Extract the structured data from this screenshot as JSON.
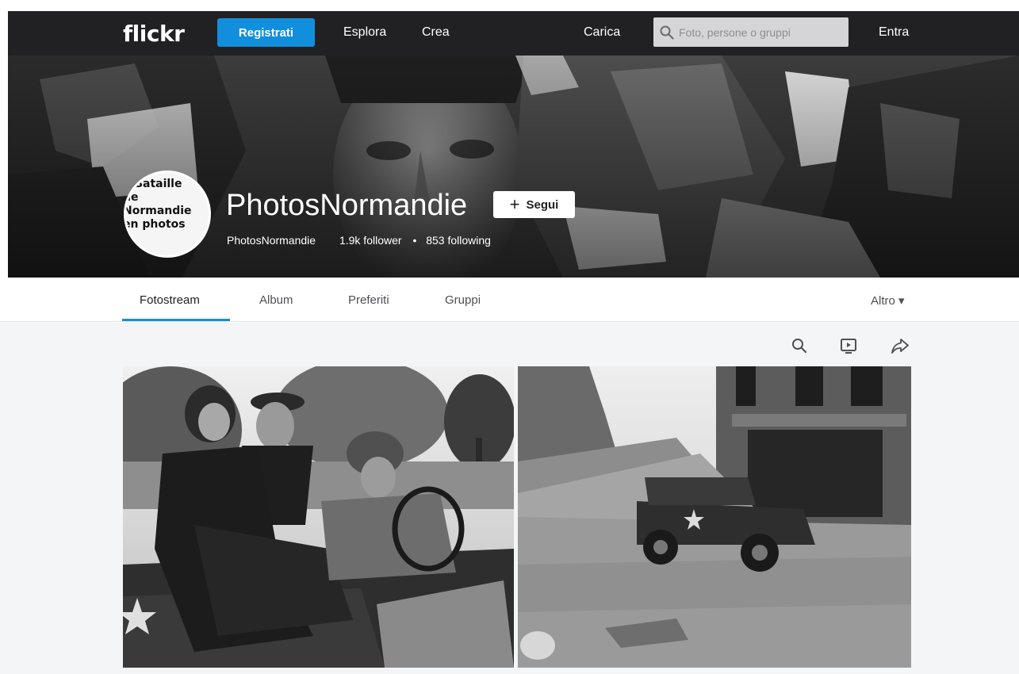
{
  "topbar": {
    "logo": "flickr",
    "signup_label": "Registrati",
    "nav": {
      "explore": "Esplora",
      "create": "Crea",
      "upload": "Carica",
      "login": "Entra"
    },
    "search": {
      "placeholder": "Foto, persone o gruppi",
      "value": ""
    },
    "icon": "search-icon"
  },
  "profile": {
    "avatar_text": "a Bataille\nde\nNormandie\nen photos",
    "name": "PhotosNormandie",
    "follow_label": "Segui",
    "username": "PhotosNormandie",
    "followers": "1.9k follower",
    "following": "853 following"
  },
  "subnav": {
    "tabs": [
      "Fotostream",
      "Album",
      "Preferiti",
      "Gruppi"
    ],
    "active_tab": "Fotostream",
    "more_label": "Altro ▾"
  },
  "toolbar": {
    "icons": [
      "search-icon",
      "slideshow-icon",
      "share-icon"
    ]
  },
  "photos": [
    {
      "description_icon": "photo-elderly-woman-and-soldier-in-jeep"
    },
    {
      "description_icon": "photo-jeep-in-ruined-street"
    }
  ],
  "colors": {
    "topbar_bg": "#212124",
    "accent": "#128fdc",
    "content_bg": "#f3f5f6"
  }
}
